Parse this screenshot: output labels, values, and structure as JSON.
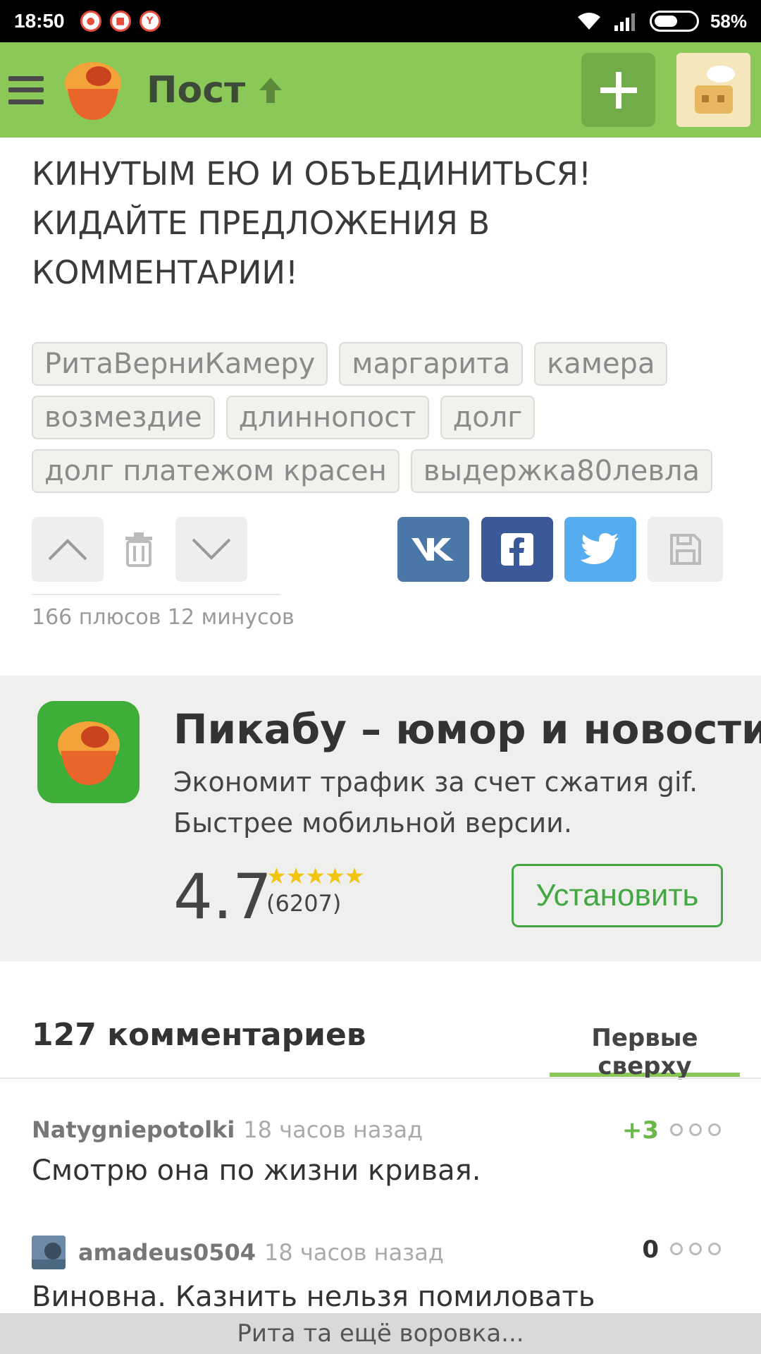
{
  "status_bar": {
    "time": "18:50",
    "battery_percent": "58%",
    "battery_level": 0.58
  },
  "appbar": {
    "title": "Пост",
    "menu_icon": "hamburger-menu-icon",
    "add_icon": "plus-icon",
    "colors": {
      "bar": "#8ac858",
      "add_button": "#72ad4a"
    }
  },
  "post": {
    "text_lines": [
      "КИНУТЫМ ЕЮ И ОБЪЕДИНИТЬСЯ!",
      "КИДАЙТЕ ПРЕДЛОЖЕНИЯ В",
      "КОММЕНТАРИИ!"
    ],
    "tags": [
      [
        "РитаВерниКамеру",
        "маргарита",
        "камера"
      ],
      [
        "возмездие",
        "длиннопост",
        "долг"
      ],
      [
        "долг платежом красен",
        "выдержка80левла"
      ]
    ],
    "votes_text": "166 плюсов 12 минусов",
    "share_colors": {
      "vk": "#4a76a8",
      "facebook": "#3b5998",
      "twitter": "#55acee",
      "save": "#eeeeec"
    }
  },
  "ad": {
    "title": "Пикабу – юмор и новости",
    "desc_line1": "Экономит трафик за счет сжатия gif.",
    "desc_line2": "Быстрее мобильной версии.",
    "rating": "4.7",
    "stars": "★★★★★",
    "review_count": "(6207)",
    "install_label": "Установить"
  },
  "comments_header": {
    "count_label": "127 комментариев",
    "sort_label": "Первые сверху"
  },
  "comments": [
    {
      "author": "Natygniepotolki",
      "time": "18 часов назад",
      "rating": "+3",
      "text": "Смотрю она по жизни кривая.",
      "rating_color": "#6bb84a"
    },
    {
      "author": "amadeus0504",
      "time": "18 часов назад",
      "rating": "0",
      "text": "Виновна. Казнить нельзя помиловать",
      "rating_color": "#333333"
    }
  ],
  "bottom_bar": {
    "text": "Рита та ещё воровка..."
  }
}
